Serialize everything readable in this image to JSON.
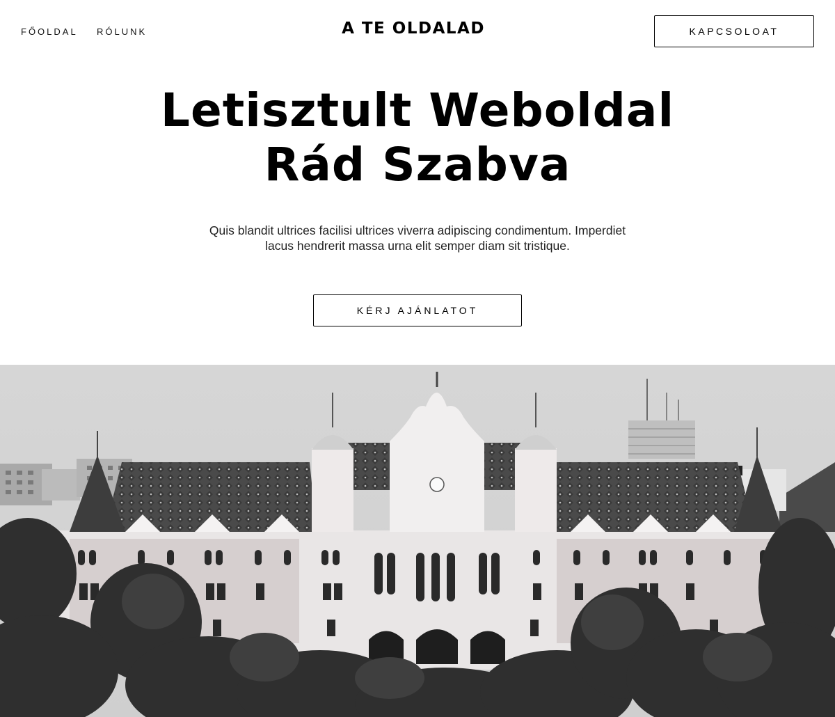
{
  "nav": {
    "items": [
      {
        "label": "FŐOLDAL"
      },
      {
        "label": "RÓLUNK"
      }
    ]
  },
  "header": {
    "brand": "A TE OLDALAD",
    "contact_label": "KAPCSOLOAT"
  },
  "hero": {
    "title_line1": "Letisztult Weboldal",
    "title_line2": "Rád Szabva",
    "text_line1": "Quis blandit ultrices facilisi ultrices viverra adipiscing condimentum. Imperdiet",
    "text_line2": "lacus hendrerit massa urna elit semper diam sit tristique.",
    "cta_label": "KÉRJ AJÁNLATOT"
  },
  "image": {
    "subject": "grayscale-photo-ornate-city-hall"
  }
}
